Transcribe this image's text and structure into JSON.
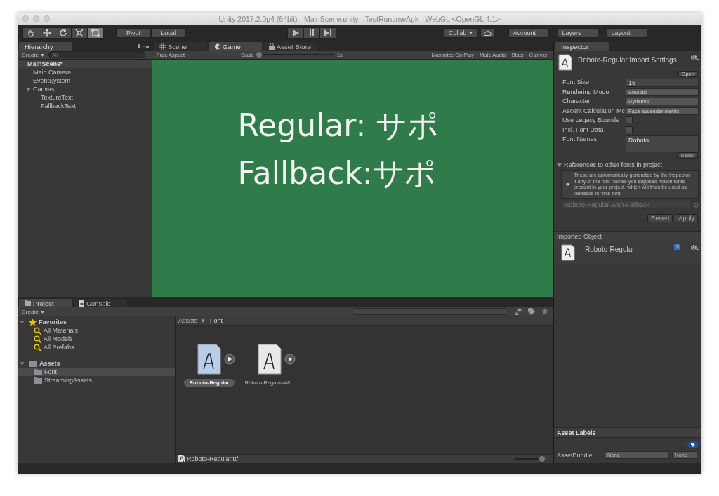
{
  "window": {
    "title": "Unity 2017.2.0p4 (64bit) - MainScene.unity - TestRuntimeApk - WebGL <OpenGL 4.1>"
  },
  "toolbar": {
    "tools": [
      {
        "kind": "hand",
        "selected": false
      },
      {
        "kind": "move",
        "selected": false
      },
      {
        "kind": "rotate",
        "selected": false
      },
      {
        "kind": "scale",
        "selected": false
      },
      {
        "kind": "rect",
        "selected": true
      }
    ],
    "pivot": "Pivot",
    "local": "Local",
    "collab": "Collab",
    "account": "Account",
    "layers": "Layers",
    "layout": "Layout"
  },
  "hierarchy": {
    "tab": "Hierarchy",
    "create": "Create",
    "search_placeholder": "All",
    "scene": "MainScene*",
    "items": [
      {
        "label": "Main Camera"
      },
      {
        "label": "EventSystem"
      },
      {
        "label": "Canvas",
        "expanded": true,
        "children": [
          {
            "label": "TextureText"
          },
          {
            "label": "FallbackText"
          }
        ]
      }
    ]
  },
  "center_tabs": [
    {
      "label": "Scene",
      "kind": "scene",
      "selected": false
    },
    {
      "label": "Game",
      "kind": "game",
      "selected": true
    },
    {
      "label": "Asset Store",
      "kind": "store",
      "selected": false
    }
  ],
  "game_bar": {
    "aspect": "Free Aspect",
    "scale_label": "Scale",
    "scale_value": "1x",
    "level": 0,
    "buttons": [
      "Maximize On Play",
      "Mute Audio",
      "Stats",
      "Gizmos"
    ]
  },
  "game_view": {
    "lines": [
      "Regular: サポ",
      "Fallback:サポ"
    ]
  },
  "inspector": {
    "tab": "Inspector",
    "title": "Roboto-Regular Import Settings",
    "open": "Open",
    "fields": [
      {
        "kind": "text",
        "label": "Font Size",
        "value": "16"
      },
      {
        "kind": "dropdown",
        "label": "Rendering Mode",
        "value": "Smooth"
      },
      {
        "kind": "dropdown",
        "label": "Character",
        "value": "Dynamic"
      },
      {
        "kind": "dropdown",
        "label": "Ascent Calculation Mc",
        "value": "Face ascender metric"
      },
      {
        "kind": "checkbox",
        "label": "Use Legacy Bounds",
        "checked": false
      },
      {
        "kind": "checkbox",
        "label": "Incl. Font Data",
        "checked": false
      },
      {
        "kind": "textarea",
        "label": "Font Names",
        "value": "Roboto"
      }
    ],
    "reset": "Reset",
    "references": {
      "title": "References to other fonts in project",
      "expanded": true,
      "note": "These are automatically generated by the inspector if any of the font names you supplied match fonts present in your project, which will then be used as fallbacks for this font.",
      "font": "Roboto-Regular-With-Fallback"
    },
    "revert": "Revert",
    "apply": "Apply",
    "imported_title": "Imported Object",
    "imported_name": "Roboto-Regular",
    "asset_labels": "Asset Labels",
    "asset_bundle": {
      "label": "AssetBundle",
      "name": "None",
      "variant": "None"
    }
  },
  "project_tabs": [
    {
      "label": "Project",
      "kind": "project",
      "selected": true
    },
    {
      "label": "Console",
      "kind": "console",
      "selected": false
    }
  ],
  "project": {
    "create": "Create",
    "tree": [
      {
        "label": "Favorites",
        "kind": "favorites",
        "selected": false,
        "expanded": true,
        "children": [
          {
            "label": "All Materials",
            "kind": "search",
            "selected": false
          },
          {
            "label": "All Models",
            "kind": "search",
            "selected": false
          },
          {
            "label": "All Prefabs",
            "kind": "search",
            "selected": false
          }
        ]
      },
      {
        "label": "Assets",
        "kind": "folder",
        "selected": false,
        "expanded": true,
        "children": [
          {
            "label": "Font",
            "kind": "folder",
            "selected": true
          },
          {
            "label": "StreamingAssets",
            "kind": "folder",
            "selected": false
          }
        ]
      }
    ],
    "breadcrumb": [
      "Assets",
      "Font"
    ],
    "assets": [
      {
        "name": "Roboto-Regular",
        "kind": "font",
        "selected": true
      },
      {
        "name": "Roboto-Regular-Wi...",
        "kind": "font-plain",
        "selected": false
      }
    ],
    "footer_file": "Roboto-Regular.ttf",
    "icon_size": {
      "level": 1
    }
  }
}
